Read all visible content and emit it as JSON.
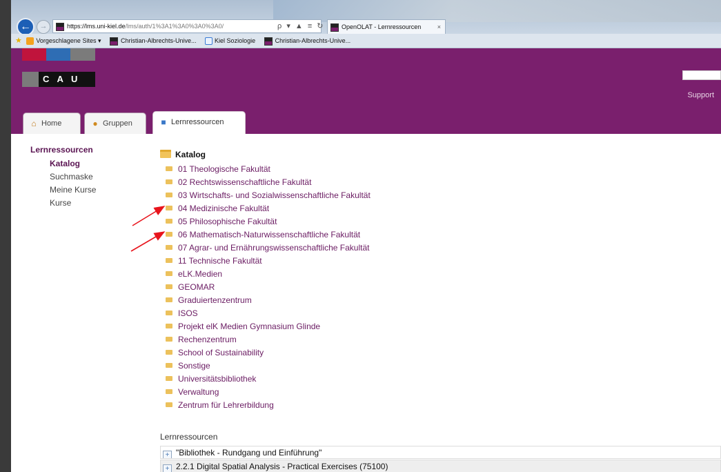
{
  "browser": {
    "address_host": "https://lms.uni-kiel.de",
    "address_path": "/lms/auth/1%3A1%3A0%3A0%3A0/",
    "address_tools": "ρ ▾ ▲ ≡ ↻",
    "tab_title": "OpenOLAT - Lernressourcen",
    "tab_close": "×",
    "favorites": [
      {
        "label": "Vorgeschlagene Sites ▾"
      },
      {
        "label": "Christian-Albrechts-Unive..."
      },
      {
        "label": "Kiel Soziologie"
      },
      {
        "label": "Christian-Albrechts-Unive..."
      }
    ]
  },
  "header": {
    "logo_text": "C A U",
    "support_label": "Support",
    "logo_colors": [
      "#c0143c",
      "#2e6db4",
      "#7b7b7b"
    ]
  },
  "tabs": [
    {
      "label": "Home",
      "icon": "home-icon"
    },
    {
      "label": "Gruppen",
      "icon": "group-icon"
    },
    {
      "label": "Lernressourcen",
      "icon": "book-icon",
      "active": true
    }
  ],
  "sidebar": {
    "heading": "Lernressourcen",
    "items": [
      {
        "label": "Katalog",
        "active": true
      },
      {
        "label": "Suchmaske"
      },
      {
        "label": "Meine Kurse"
      },
      {
        "label": "Kurse"
      }
    ]
  },
  "catalog": {
    "title": "Katalog",
    "entries": [
      "01 Theologische Fakultät",
      "02 Rechtswissenschaftliche Fakultät",
      "03 Wirtschafts- und Sozialwissenschaftliche Fakultät",
      "04 Medizinische Fakultät",
      "05 Philosophische Fakultät",
      "06 Mathematisch-Naturwissenschaftliche Fakultät",
      "07 Agrar- und Ernährungswissenschaftliche Fakultät",
      "11 Technische Fakultät",
      "eLK.Medien",
      "GEOMAR",
      "Graduiertenzentrum",
      "ISOS",
      "Projekt elK Medien Gymnasium Glinde",
      "Rechenzentrum",
      "School of Sustainability",
      "Sonstige",
      "Universitätsbibliothek",
      "Verwaltung",
      "Zentrum für Lehrerbildung"
    ]
  },
  "resources": {
    "title": "Lernressourcen",
    "rows": [
      "\"Bibliothek - Rundgang und Einführung\"",
      "2.2.1 Digital Spatial Analysis - Practical Exercises (75100)"
    ]
  },
  "annotations": {
    "arrow_color": "#e8141c"
  }
}
